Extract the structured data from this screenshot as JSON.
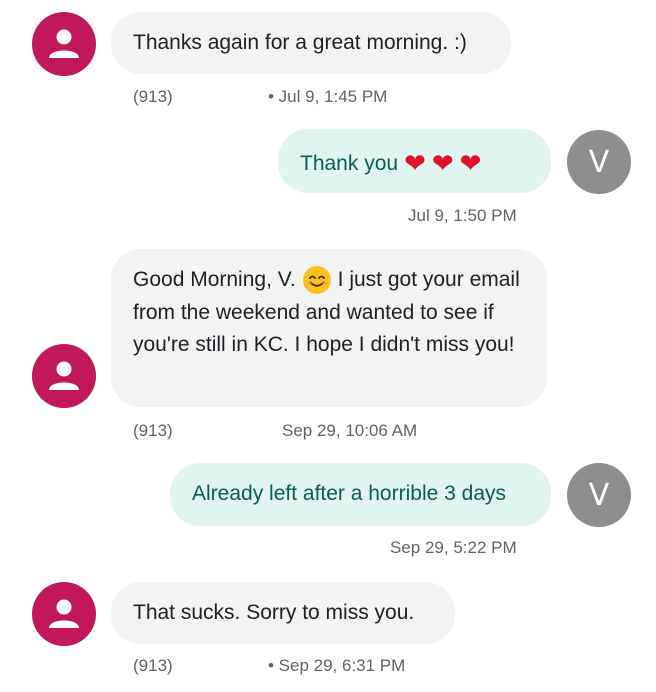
{
  "messages": [
    {
      "text": "Thanks again for a great morning. :)",
      "phone": "(913)",
      "time": "• Jul 9, 1:45 PM"
    },
    {
      "text": "Thank you",
      "time": "Jul 9, 1:50 PM",
      "avatar_letter": "V",
      "emoji": [
        "❤",
        "❤",
        "❤"
      ]
    },
    {
      "text_before_emoji": "Good Morning, V.",
      "text_after_emoji": "I just got your email from the weekend and wanted to see if you're still in KC. I hope I didn't miss you!",
      "phone": "(913)",
      "time": "Sep 29, 10:06 AM"
    },
    {
      "text": "Already left after a horrible 3 days",
      "time": "Sep 29, 5:22 PM",
      "avatar_letter": "V"
    },
    {
      "text": "That sucks. Sorry to miss you.",
      "phone": "(913)",
      "time": "• Sep 29, 6:31 PM"
    }
  ]
}
